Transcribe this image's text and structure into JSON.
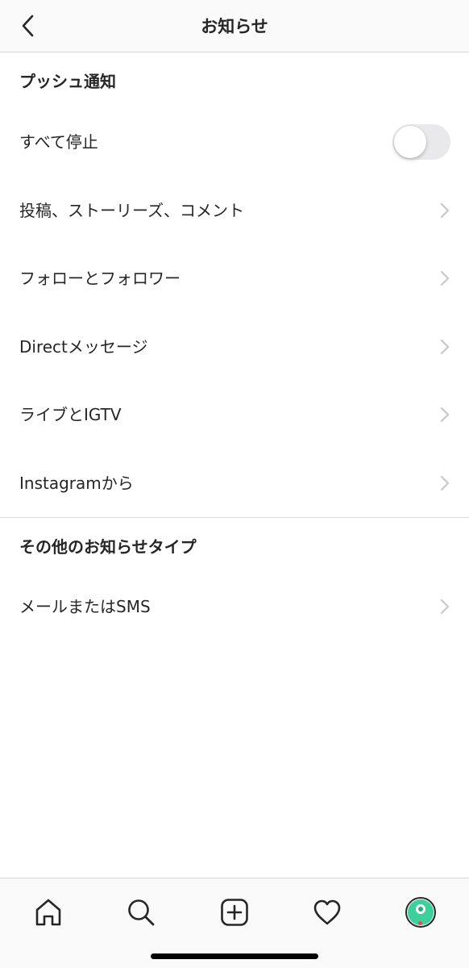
{
  "header": {
    "title": "お知らせ",
    "back_icon": "chevron-left-icon"
  },
  "push_section": {
    "title": "プッシュ通知",
    "pause_all": {
      "label": "すべて停止",
      "toggle_on": false
    },
    "items": [
      {
        "label": "投稿、ストーリーズ、コメント"
      },
      {
        "label": "フォローとフォロワー"
      },
      {
        "label": "Directメッセージ"
      },
      {
        "label": "ライブとIGTV"
      },
      {
        "label": "Instagramから"
      }
    ]
  },
  "other_section": {
    "title": "その他のお知らせタイプ",
    "items": [
      {
        "label": "メールまたはSMS"
      }
    ]
  },
  "tabbar": {
    "tabs": [
      {
        "name": "home",
        "icon": "home-icon"
      },
      {
        "name": "search",
        "icon": "search-icon"
      },
      {
        "name": "new-post",
        "icon": "plus-square-icon"
      },
      {
        "name": "activity",
        "icon": "heart-icon"
      },
      {
        "name": "profile",
        "icon": "avatar"
      }
    ],
    "has_notification_dot": true
  },
  "colors": {
    "text": "#262626",
    "chevron": "#c7c7cc",
    "divider": "#dbdbdb",
    "toggle_off": "#e9e9eb",
    "avatar": "#3ed09c",
    "notification_dot": "#ed4956"
  }
}
